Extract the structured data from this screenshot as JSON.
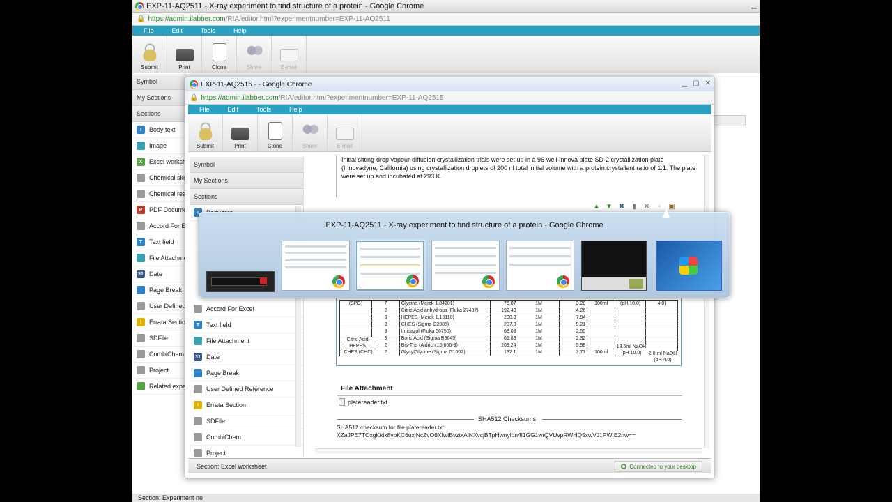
{
  "outer": {
    "title": "EXP-11-AQ2511 - X-ray experiment to find structure of a protein - Google Chrome",
    "url_host": "https://admin.ilabber.com",
    "url_path": "/RIA/editor.html?experimentnumber=EXP-11-AQ2511",
    "menu": [
      "File",
      "Edit",
      "Tools",
      "Help"
    ],
    "toolbar": [
      "Submit",
      "Print",
      "Clone",
      "Share",
      "E-mail"
    ],
    "side_heads": [
      "Symbol",
      "My Sections",
      "Sections"
    ],
    "sections": [
      "Body text",
      "Image",
      "Excel workshe",
      "Chemical sket",
      "Chemical reac",
      "PDF Documen",
      "Accord For Ex",
      "Text field",
      "File Attachmen",
      "Date",
      "Page Break",
      "User Defined R",
      "Errata Section",
      "SDFile",
      "CombiChem",
      "Project",
      "Related exper"
    ],
    "status": "Section: Experiment ne"
  },
  "inner": {
    "title": "EXP-11-AQ2515 - - Google Chrome",
    "url_host": "https://admin.ilabber.com",
    "url_path": "/RIA/editor.html?experimentnumber=EXP-11-AQ2515",
    "menu": [
      "File",
      "Edit",
      "Tools",
      "Help"
    ],
    "toolbar": [
      "Submit",
      "Print",
      "Clone",
      "Share",
      "E-mail"
    ],
    "side_heads": [
      "Symbol",
      "My Sections",
      "Sections"
    ],
    "sections_top": [
      "Body text"
    ],
    "sections": [
      "Accord For Excel",
      "Text field",
      "File Attachment",
      "Date",
      "Page Break",
      "User Defined Reference",
      "Errata Section",
      "SDFile",
      "CombiChem",
      "Project"
    ],
    "paragraph": "Initial sitting-drop vapour-diffusion crystallization trials were set up in a 96-well Innova plate SD-2 crystallization plate (Innovadyne, California) using crystallization droplets of 200 nl total initial volume with a protein:crystallant ratio of 1:1. The plate were set up and incubated at 293 K.",
    "table": {
      "rows": [
        [
          "(SPG)",
          "7",
          "Glycine (Merck 1.04201)",
          "75.07",
          "1M",
          "3.28",
          "100ml",
          "(pH 10.0)",
          "4.0)"
        ],
        [
          "",
          "2",
          "Citric Acid anhydrous (Fluka 27487)",
          "192.43",
          "1M",
          "4.26",
          "",
          "",
          ""
        ],
        [
          "",
          "3",
          "HEPES (Merck 1.10110)",
          "238.3",
          "1M",
          "7.94",
          "",
          "",
          ""
        ],
        [
          "",
          "3",
          "CHES (Sigma C2885)",
          "207.3",
          "1M",
          "9.21",
          "",
          "",
          ""
        ],
        [
          "",
          "3",
          "Imidazol (Fluka 56750)",
          "68.08",
          "1M",
          "2.55",
          "",
          "",
          ""
        ],
        [
          "",
          "3",
          "Boric Acid (Sigma B9645)",
          "61.83",
          "1M",
          "2.32",
          "",
          "",
          ""
        ],
        [
          "",
          "2",
          "Bis-Tris (Aldrich 15,666-3)",
          "209.24",
          "1M",
          "5.98",
          "",
          "",
          ""
        ],
        [
          "",
          "2",
          "GlycylGlycine (Sigma G1002)",
          "132.1",
          "1M",
          "3.77",
          "100ml",
          "",
          ""
        ]
      ],
      "group_label": "Citric Acid, HEPES, CHES (CHC)",
      "naoh_1": "13.5ml NaOH (pH 10.0)",
      "naoh_2": "2.0 ml NaOH (pH 4.0)"
    },
    "file_attachment_heading": "File Attachment",
    "file_name": "platereader.txt",
    "sha_heading": "SHA512 Checksums",
    "sha_label": "SHA512 checksum for file platereader.txt:",
    "sha_value": "XZaJPE7TOxgKkix8vbKC6uxjNcZvO6XIwIBvztxAlNXvcjBTpHwnylon4l1GG1wtQVUvpRWHQ5xwVJ1PWIE2nw==",
    "status": "Section: Excel worksheet",
    "connected": "Connected to your desktop"
  },
  "preview": {
    "title": "EXP-11-AQ2511 - X-ray experiment to find structure of a protein - Google Chrome"
  }
}
